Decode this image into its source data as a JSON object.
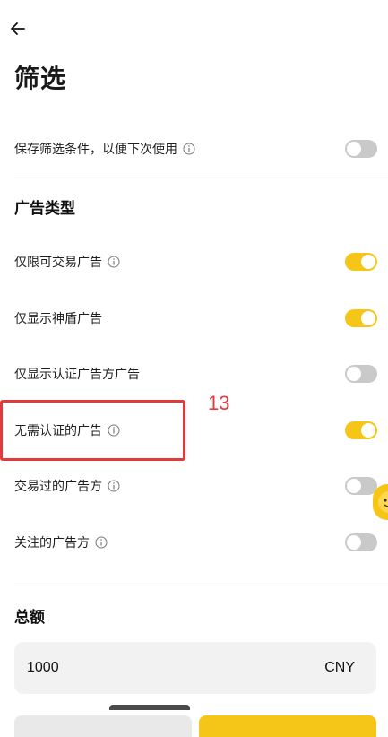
{
  "header": {
    "back_icon": "arrow-left-icon",
    "title": "筛选"
  },
  "save_filter": {
    "label": "保存筛选条件，以便下次使用",
    "enabled": false
  },
  "ad_types": {
    "title": "广告类型",
    "items": [
      {
        "label": "仅限可交易广告",
        "info": true,
        "enabled": true
      },
      {
        "label": "仅显示神盾广告",
        "info": false,
        "enabled": true
      },
      {
        "label": "仅显示认证广告方广告",
        "info": false,
        "enabled": false
      },
      {
        "label": "无需认证的广告",
        "info": true,
        "enabled": true
      },
      {
        "label": "交易过的广告方",
        "info": true,
        "enabled": false
      },
      {
        "label": "关注的广告方",
        "info": true,
        "enabled": false
      }
    ]
  },
  "amount": {
    "title": "总额",
    "value": "1000",
    "currency": "CNY"
  },
  "annotation": {
    "number": "13",
    "color": "#e23b3b"
  },
  "colors": {
    "toggle_on": "#f5c518",
    "toggle_off": "#c9c9c9"
  }
}
